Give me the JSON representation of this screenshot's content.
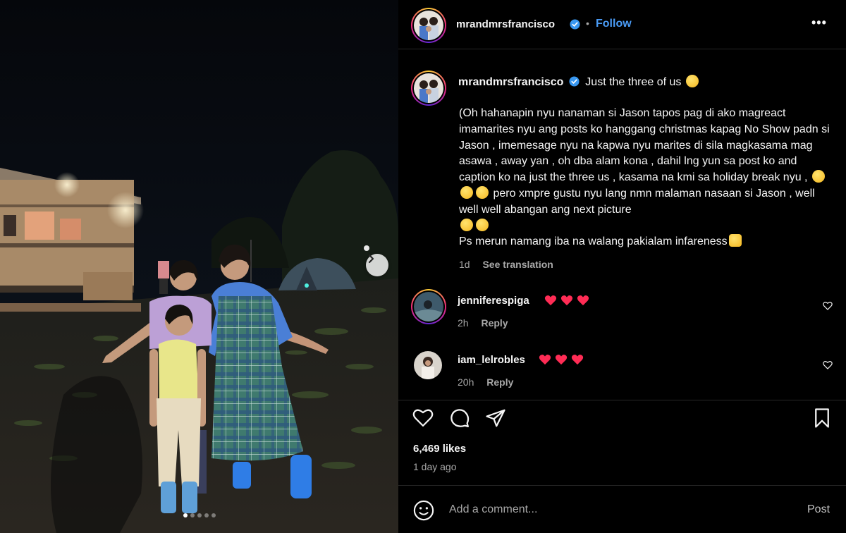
{
  "post": {
    "username": "mrandmrsfrancisco",
    "follow_sep": "•",
    "follow_label": "Follow",
    "more_label": "•••"
  },
  "caption": {
    "username": "mrandmrsfrancisco",
    "title": "Just the three of us",
    "body": "(Oh hahanapin nyu nanaman si Jason tapos pag di ako magreact imamarites nyu ang posts ko hanggang christmas kapag No Show padn si Jason , imemesage nyu na kapwa nyu marites di sila magkasama mag asawa , away yan , oh dba alam kona , dahil lng yun sa post ko and caption ko na just the three us , kasama na kmi sa holiday break nyu ,",
    "body2": "pero xmpre gustu nyu lang nmn malaman nasaan si Jason , well well well abangan ang next picture",
    "body3": "Ps merun namang iba na walang pakialam infareness",
    "age": "1d",
    "see_translation": "See translation"
  },
  "comments": [
    {
      "username": "jenniferespiga",
      "age": "2h",
      "reply": "Reply"
    },
    {
      "username": "iam_lelrobles",
      "age": "20h",
      "reply": "Reply"
    }
  ],
  "likes": "6,469 likes",
  "time_ago": "1 day ago",
  "add_comment": {
    "placeholder": "Add a comment...",
    "post_label": "Post"
  },
  "carousel": {
    "count": 5,
    "active": 0
  },
  "colors": {
    "accent": "#4a9bf5",
    "heart": "#ff2c55",
    "verified": "#3897f0"
  }
}
